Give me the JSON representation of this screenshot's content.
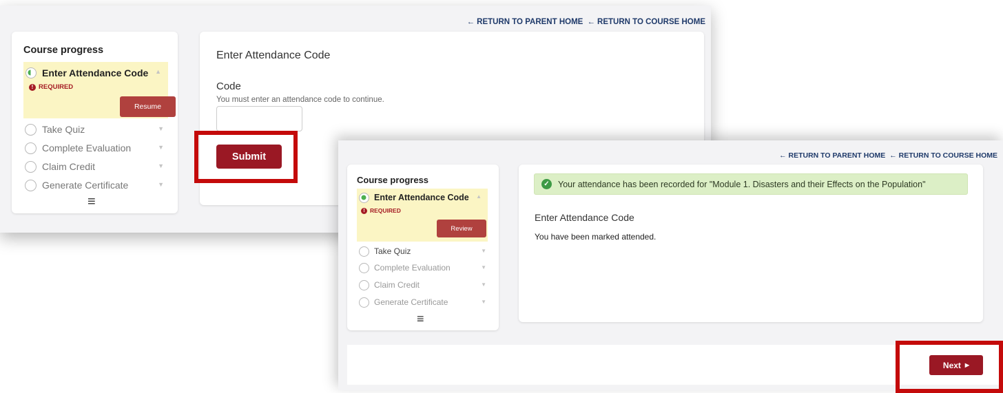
{
  "screen1": {
    "links": {
      "parent": "← RETURN TO PARENT HOME",
      "course": "← RETURN TO COURSE HOME"
    },
    "sidebar": {
      "title": "Course progress",
      "active_step": {
        "label": "Enter Attendance Code",
        "status": "REQUIRED",
        "button": "Resume"
      },
      "steps": [
        "Take Quiz",
        "Complete Evaluation",
        "Claim Credit",
        "Generate Certificate"
      ],
      "menu_icon": "≡"
    },
    "main": {
      "heading": "Enter Attendance Code",
      "field_label": "Code",
      "field_help": "You must enter an attendance code to continue.",
      "code_value": "",
      "submit_label": "Submit"
    }
  },
  "screen2": {
    "links": {
      "parent": "← RETURN TO PARENT HOME",
      "course": "← RETURN TO COURSE HOME"
    },
    "sidebar": {
      "title": "Course progress",
      "active_step": {
        "label": "Enter Attendance Code",
        "status": "REQUIRED",
        "button": "Review"
      },
      "steps": [
        "Take Quiz",
        "Complete Evaluation",
        "Claim Credit",
        "Generate Certificate"
      ],
      "menu_icon": "≡"
    },
    "main": {
      "alert": "Your attendance has been recorded for \"Module 1. Disasters and their Effects on the Population\"",
      "heading": "Enter Attendance Code",
      "message": "You have been marked attended."
    },
    "footer": {
      "next_label": "Next"
    }
  },
  "icons": {
    "progress": "half-circle-progress-icon",
    "required": "exclamation-circle-icon",
    "step": "empty-circle-icon",
    "caret": "caret-icon",
    "menu": "hamburger-menu-icon",
    "success": "check-circle-icon",
    "next": "caret-right-icon"
  },
  "colors": {
    "brand": "#9a1824",
    "highlight_box": "#c40a0a",
    "active_step_bg": "#fbf5c4",
    "success_bg": "#dcefc6",
    "link": "#1f3a6a"
  }
}
